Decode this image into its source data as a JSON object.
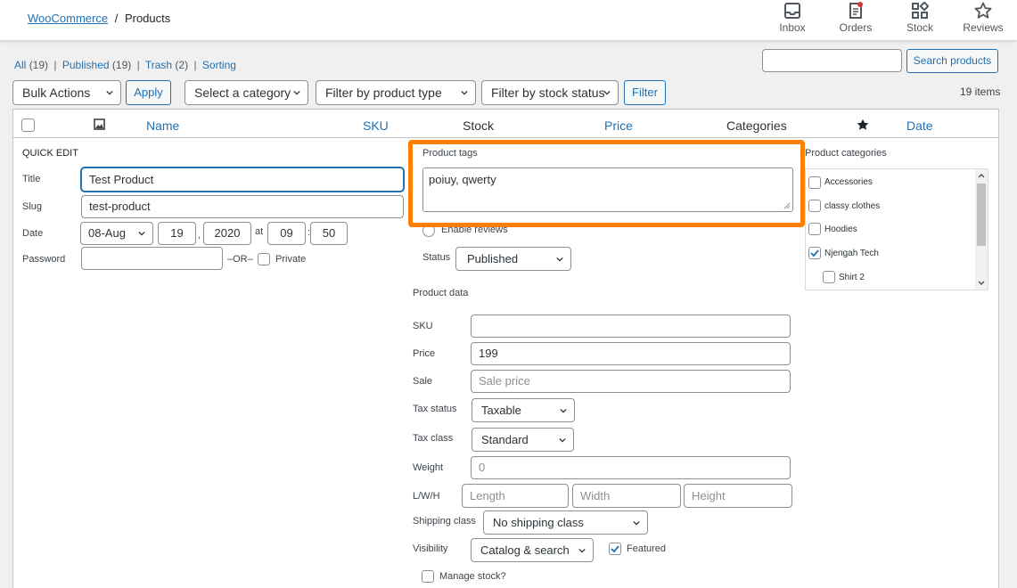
{
  "breadcrumb": {
    "root": "WooCommerce",
    "sep": "/",
    "current": "Products"
  },
  "activity": [
    {
      "label": "Inbox",
      "icon": "inbox-icon"
    },
    {
      "label": "Orders",
      "icon": "orders-icon"
    },
    {
      "label": "Stock",
      "icon": "stock-icon"
    },
    {
      "label": "Reviews",
      "icon": "star-icon"
    }
  ],
  "subsubsub": {
    "all": "All",
    "all_count": "(19)",
    "published": "Published",
    "published_count": "(19)",
    "trash": "Trash",
    "trash_count": "(2)",
    "sorting": "Sorting",
    "sep": "|"
  },
  "search": {
    "button": "Search products",
    "value": ""
  },
  "filters": {
    "bulk_actions": "Bulk Actions",
    "apply": "Apply",
    "category": "Select a category",
    "product_type": "Filter by product type",
    "stock_status": "Filter by stock status",
    "filter": "Filter",
    "items_count": "19 items"
  },
  "columns": {
    "name": "Name",
    "sku": "SKU",
    "stock": "Stock",
    "price": "Price",
    "categories": "Categories",
    "date": "Date"
  },
  "quick_edit": {
    "heading": "QUICK EDIT",
    "title_label": "Title",
    "title_value": "Test Product",
    "slug_label": "Slug",
    "slug_value": "test-product",
    "date_label": "Date",
    "month": "08-Aug",
    "day": "19",
    "year": "2020",
    "at": "at",
    "hour": "09",
    "colon": ":",
    "minute": "50",
    "comma": ",",
    "password_label": "Password",
    "or": "–OR–",
    "private": "Private"
  },
  "tags": {
    "label": "Product tags",
    "value": "poiuy, qwerty"
  },
  "enable_reviews": "Enable reviews",
  "status": {
    "label": "Status",
    "value": "Published"
  },
  "product_data": {
    "heading": "Product data",
    "sku_label": "SKU",
    "sku_value": "",
    "price_label": "Price",
    "price_value": "199",
    "sale_label": "Sale",
    "sale_placeholder": "Sale price",
    "tax_status_label": "Tax status",
    "tax_status_value": "Taxable",
    "tax_class_label": "Tax class",
    "tax_class_value": "Standard",
    "weight_label": "Weight",
    "weight_placeholder": "0",
    "lwh_label": "L/W/H",
    "length_placeholder": "Length",
    "width_placeholder": "Width",
    "height_placeholder": "Height",
    "shipping_label": "Shipping class",
    "shipping_value": "No shipping class",
    "visibility_label": "Visibility",
    "visibility_value": "Catalog & search",
    "featured": "Featured",
    "manage_stock": "Manage stock?"
  },
  "categories": {
    "heading": "Product categories",
    "items": [
      {
        "label": "Accessories",
        "checked": false
      },
      {
        "label": "classy clothes",
        "checked": false
      },
      {
        "label": "Hoodies",
        "checked": false
      },
      {
        "label": "Njengah Tech",
        "checked": true
      },
      {
        "label": "Shirt 2",
        "checked": false
      }
    ]
  },
  "colors": {
    "link": "#2271b1",
    "highlight": "#ff7f00"
  }
}
